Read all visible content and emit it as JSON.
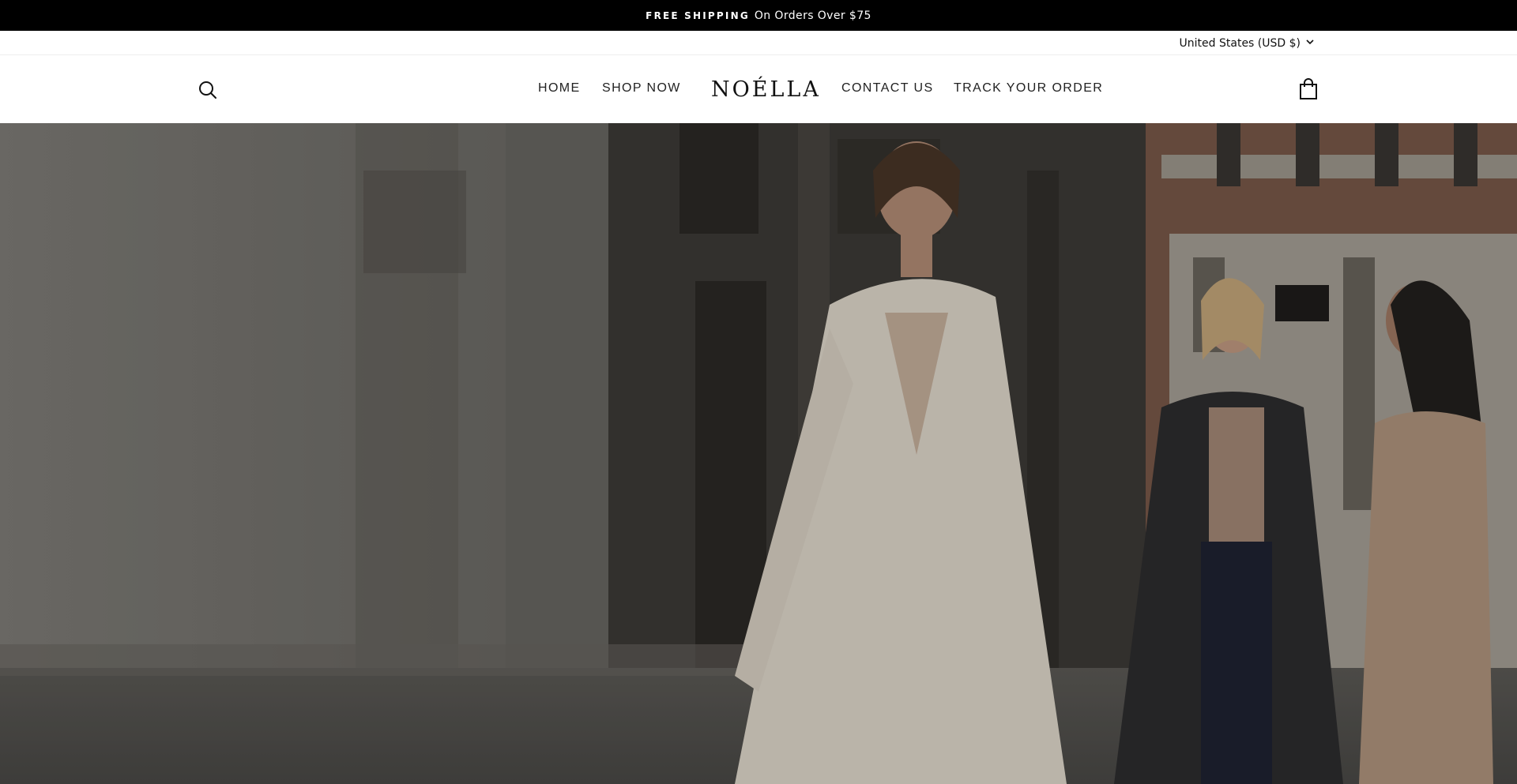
{
  "announcement": {
    "strong": "FREE SHIPPING",
    "rest": "On Orders Over $75"
  },
  "locale": {
    "label": "United States (USD $)",
    "icon": "chevron-down-icon"
  },
  "header": {
    "search_icon": "search-icon",
    "cart_icon": "bag-icon",
    "logo": "NOÉLLA",
    "nav": {
      "home": "HOME",
      "shop": "SHOP NOW",
      "contact": "CONTACT US",
      "track": "TRACK YOUR ORDER"
    }
  },
  "colors": {
    "announcement_bg": "#000000",
    "header_bg": "#ffffff",
    "text": "#111111"
  }
}
